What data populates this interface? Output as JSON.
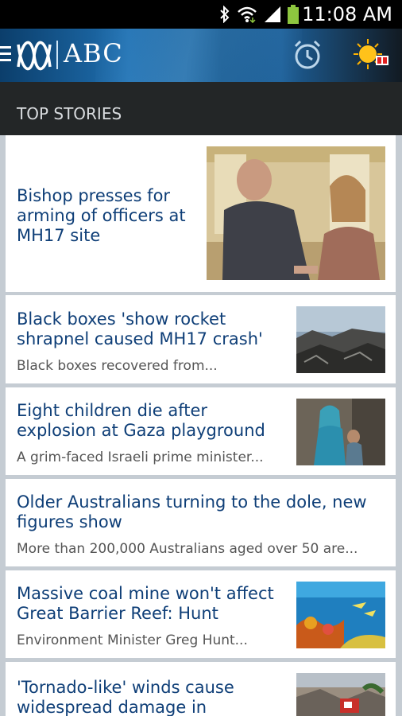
{
  "status_bar": {
    "time": "11:08 AM",
    "icons": [
      "bluetooth-icon",
      "wifi-icon",
      "signal-icon",
      "battery-icon"
    ]
  },
  "app_bar": {
    "brand": "ABC",
    "icons": [
      "menu-icon",
      "abc-logo",
      "alarm-clock-icon",
      "weather-sun-icon"
    ]
  },
  "section": {
    "title": "TOP STORIES"
  },
  "stories": [
    {
      "title": "Bishop presses for arming of officers at MH17 site",
      "summary": ""
    },
    {
      "title": "Black boxes 'show rocket shrapnel caused MH17 crash'",
      "summary": "Black boxes recovered from..."
    },
    {
      "title": "Eight children die after explosion at Gaza playground",
      "summary": "A grim-faced Israeli prime minister..."
    },
    {
      "title": "Older Australians turning to the dole, new figures show",
      "summary": "More than 200,000 Australians aged over 50 are..."
    },
    {
      "title": "Massive coal mine won't affect Great Barrier Reef: Hunt",
      "summary": "Environment Minister Greg Hunt..."
    },
    {
      "title": "'Tornado-like' winds cause widespread damage in",
      "summary": ""
    }
  ],
  "colors": {
    "headline": "#0e3e77",
    "header_blue": "#1f6fb0",
    "section_bg": "#232627"
  }
}
